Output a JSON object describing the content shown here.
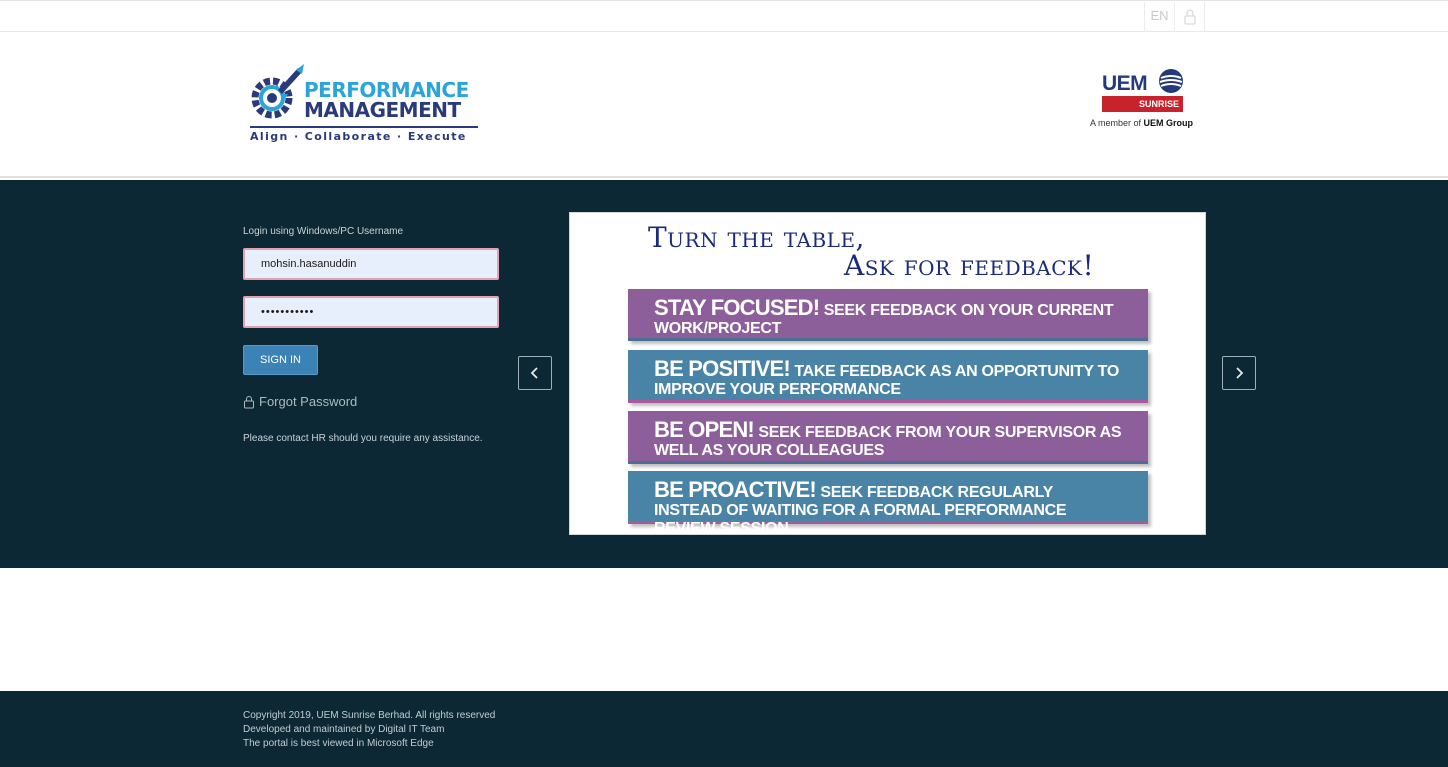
{
  "topbar": {
    "language": "EN",
    "lock_icon": "lock-icon"
  },
  "header": {
    "logo": {
      "line1": "PERFORMANCE",
      "line2": "MANAGEMENT",
      "tagline": "Align · Collaborate · Execute",
      "icon": "rocket-gear-icon"
    },
    "partner_logo": {
      "wordmark": "UEM",
      "sub": "SUNRISE",
      "member_prefix": "A member of",
      "member_group": "UEM Group"
    }
  },
  "login": {
    "caption": "Login using Windows/PC Username",
    "username_value": "mohsin.hasanuddin",
    "password_value": "•••••••••••",
    "signin_label": "SIGN IN",
    "forgot_label": "Forgot Password",
    "contact_text": "Please contact HR should you require any assistance."
  },
  "carousel": {
    "prev_icon": "chevron-left-icon",
    "next_icon": "chevron-right-icon",
    "slide": {
      "title_line1": "Turn the table,",
      "title_line2": "Ask for feedback!",
      "items": [
        {
          "head": "Stay focused!",
          "text": "Seek feedback on your current work/project"
        },
        {
          "head": "Be positive!",
          "text": "Take feedback as an opportunity to improve your performance"
        },
        {
          "head": "Be open!",
          "text": "Seek feedback from your supervisor as well as your colleagues"
        },
        {
          "head": "Be proactive!",
          "text": "Seek feedback regularly instead of waiting for a formal performance review session"
        }
      ]
    }
  },
  "footer": {
    "line1": "Copyright 2019, UEM Sunrise Berhad. All rights reserved",
    "line2": "Developed and maintained by Digital IT Team",
    "line3": "The portal is best viewed in Microsoft Edge"
  },
  "colors": {
    "dark_band": "#0c2834",
    "signin_button": "#3b82b5",
    "purple_band": "#8c5f9a",
    "blue_band": "#4983a6"
  }
}
